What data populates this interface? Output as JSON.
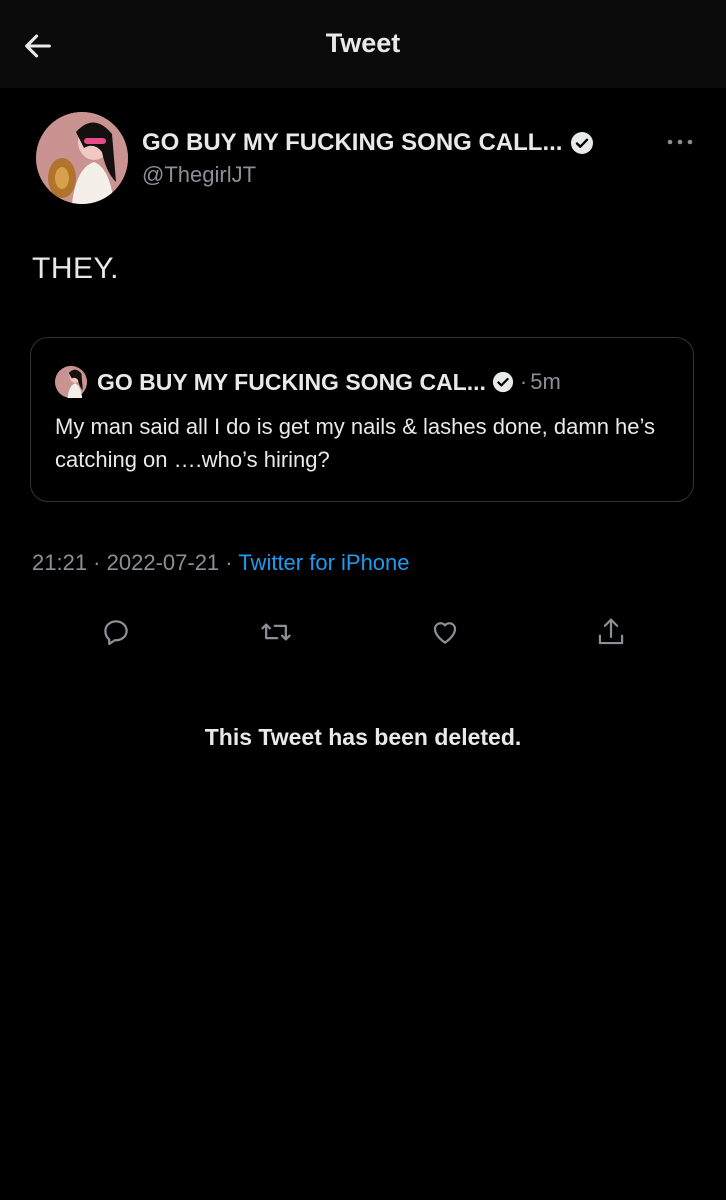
{
  "header": {
    "title": "Tweet",
    "back_icon": "arrow-left-icon"
  },
  "tweet": {
    "display_name": "GO BUY MY FUCKING SONG CALL...",
    "handle": "@ThegirlJT",
    "text": "THEY.",
    "verified_icon": "verified-badge-icon",
    "more_icon": "more-horizontal-icon"
  },
  "quote": {
    "display_name": "GO BUY MY FUCKING SONG CAL...",
    "separator": "·",
    "time": "5m",
    "text": "My man said all I do is get my nails & lashes done, damn he’s catching on ….who’s hiring?"
  },
  "meta": {
    "time": "21:21",
    "separator_1": " · ",
    "date": "2022-07-21",
    "separator_2": " · ",
    "source": "Twitter for iPhone"
  },
  "actions": {
    "icons": [
      "reply-icon",
      "retweet-icon",
      "like-icon",
      "share-icon"
    ]
  },
  "notice": {
    "deleted_text": "This Tweet has been deleted."
  },
  "colors": {
    "background": "#000000",
    "header_bg": "#0b0b0b",
    "text_primary": "#e7e9ea",
    "text_secondary": "#8b9096",
    "link": "#1d9bf0",
    "border": "#2f3336"
  }
}
